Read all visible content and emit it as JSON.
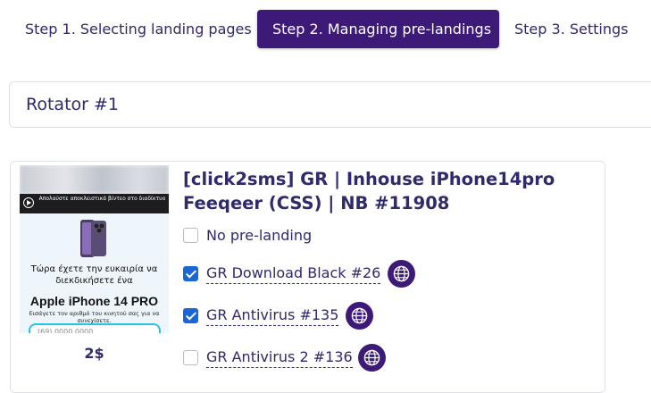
{
  "tabs": [
    {
      "label": "Step 1. Selecting landing pages",
      "active": false
    },
    {
      "label": "Step 2. Managing pre-landings",
      "active": true
    },
    {
      "label": "Step 3. Settings",
      "active": false
    }
  ],
  "rotator": {
    "name": "Rotator #1"
  },
  "offer": {
    "title": "[click2sms] GR | Inhouse iPhone14pro Feeqeer (CSS) | NB #11908",
    "price": "2$",
    "thumbnail": {
      "banner_text": "Απολαύστε αποκλειστικά βίντεο στο διαδίκτυο",
      "offer_text": "Τώρα έχετε την ευκαιρία να διεκδικήσετε ένα",
      "product": "Apple iPhone 14 PRO",
      "hint": "Εισάγετε τον αριθμό του κινητού σας για να συνεχίσετε.",
      "input_value": "(69) 0000 0000"
    },
    "options": [
      {
        "label": "No pre-landing",
        "checked": false,
        "has_globe": false
      },
      {
        "label": "GR Download Black #26",
        "checked": true,
        "has_globe": true
      },
      {
        "label": "GR Antivirus #135",
        "checked": true,
        "has_globe": true
      },
      {
        "label": "GR Antivirus 2 #136",
        "checked": false,
        "has_globe": true
      }
    ]
  },
  "icons": {
    "globe": "globe-icon",
    "play": "play-icon",
    "phone": "phone-image"
  },
  "colors": {
    "primary": "#3d1a78",
    "text": "#2e2a6b",
    "checkbox": "#1a66d9",
    "border": "#dde0e6"
  }
}
